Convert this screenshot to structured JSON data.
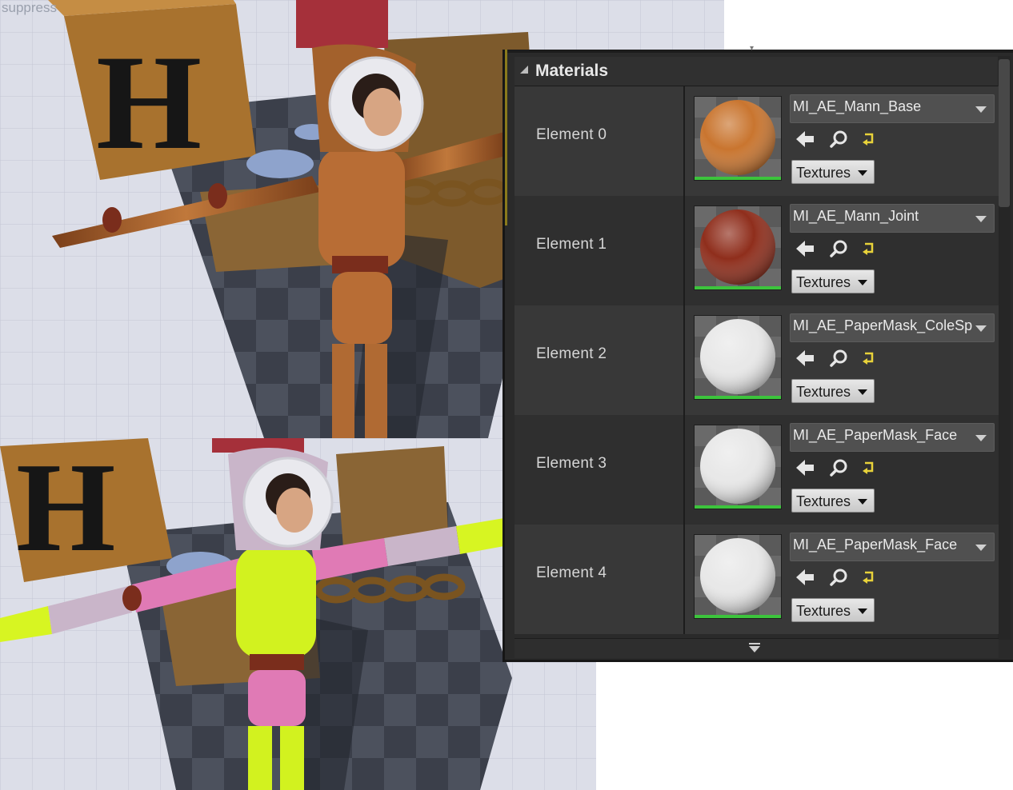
{
  "viewport": {
    "overlay_text": "suppress"
  },
  "panel": {
    "section_title": "Materials",
    "elements": [
      {
        "label": "Element 0",
        "material": "MI_AE_Mann_Base",
        "textures_label": "Textures",
        "preview_color": "#c9752f"
      },
      {
        "label": "Element 1",
        "material": "MI_AE_Mann_Joint",
        "textures_label": "Textures",
        "preview_color": "#8f2e1c"
      },
      {
        "label": "Element 2",
        "material": "MI_AE_PaperMask_ColeSpr",
        "textures_label": "Textures",
        "preview_color": "#e8e8e8"
      },
      {
        "label": "Element 3",
        "material": "MI_AE_PaperMask_Face",
        "textures_label": "Textures",
        "preview_color": "#e8e8e8"
      },
      {
        "label": "Element 4",
        "material": "MI_AE_PaperMask_Face",
        "textures_label": "Textures",
        "preview_color": "#e8e8e8"
      }
    ]
  },
  "colors": {
    "panel_bg": "#2a2a2a",
    "row_alt": "#383838",
    "accent_green": "#3cc43c",
    "reset_yellow": "#e8d23a"
  }
}
